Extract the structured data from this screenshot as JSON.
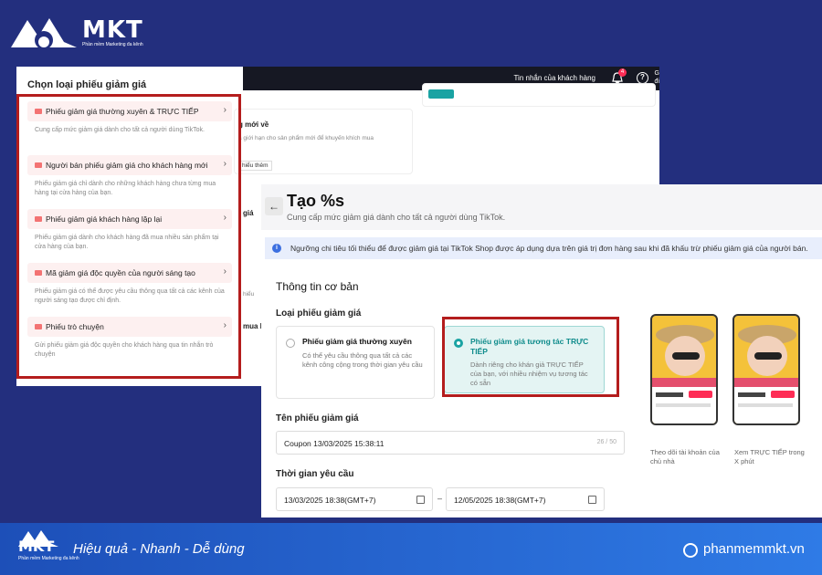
{
  "brand": {
    "name": "MKT",
    "tagline": "Phần mềm Marketing đa kênh",
    "slogan": "Hiệu quả - Nhanh - Dễ dùng",
    "website": "phanmemmkt.vn"
  },
  "topbar": {
    "messages_label": "Tin nhắn của khách hàng",
    "notification_count": "4",
    "help_symbol": "?",
    "user_initials": "G\nđi"
  },
  "voucher_type_panel": {
    "title": "Chọn loại phiếu giảm giá",
    "options": [
      {
        "label": "Phiếu giảm giá thường xuyên & TRỰC TIẾP",
        "desc": "Cung cấp mức giảm giá dành cho tất cả người dùng TikTok."
      },
      {
        "label": "Người bán phiếu giảm giá cho khách hàng mới",
        "desc": "Phiếu giảm giá chỉ dành cho những khách hàng chưa từng mua hàng tại cửa hàng của bạn."
      },
      {
        "label": "Phiếu giảm giá khách hàng lặp lại",
        "desc": "Phiếu giảm giá dành cho khách hàng đã mua nhiều sản phẩm tại cửa hàng của bạn."
      },
      {
        "label": "Mã giảm giá độc quyền của người sáng tạo",
        "desc": "Phiếu giảm giá có thể được yêu cầu thông qua tất cả các kênh của người sáng tạo được chỉ định."
      },
      {
        "label": "Phiếu trò chuyện",
        "desc": "Gửi phiếu giảm giá độc quyền cho khách hàng qua tin nhắn trò chuyện"
      }
    ]
  },
  "background_fragments": {
    "new_product_title": "g mới về",
    "new_product_desc": "à giới hạn cho sản phẩm mới để khuyến khích mua",
    "learn_more": "hiểu thêm",
    "frag_gia": "giá",
    "frag_mua": "mua l",
    "frag_hieu": "hiểu"
  },
  "create_form": {
    "back_symbol": "←",
    "title": "Tạo %s",
    "subtitle": "Cung cấp mức giảm giá dành cho tất cả người dùng TikTok.",
    "notice_icon": "i",
    "notice": "Ngưỡng chi tiêu tối thiểu để được giảm giá tại TikTok Shop được áp dụng dựa trên giá trị đơn hàng sau khi đã khấu trừ phiếu giảm giá của người bán.",
    "section_basic": "Thông tin cơ bản",
    "voucher_type_label": "Loại phiếu giảm giá",
    "types": [
      {
        "title": "Phiếu giảm giá thường xuyên",
        "desc": "Có thể yêu cầu thông qua tất cả các kênh công cộng trong thời gian yêu cầu",
        "selected": false
      },
      {
        "title": "Phiếu giảm giá tương tác TRỰC TIẾP",
        "desc": "Dành riêng cho khán giả TRỰC TIẾP của bạn, với nhiều nhiệm vụ tương tác có sẵn",
        "selected": true
      }
    ],
    "name_label": "Tên phiếu giảm giá",
    "name_value": "Coupon 13/03/2025 15:38:11",
    "name_counter": "26 / 50",
    "time_label": "Thời gian yêu cầu",
    "start_time": "13/03/2025 18:38(GMT+7)",
    "time_separator": "–",
    "end_time": "12/05/2025 18:38(GMT+7)",
    "preview_captions": [
      "Theo dõi tài khoản của chủ nhà",
      "Xem TRỰC TIẾP trong X phút"
    ]
  },
  "colors": {
    "accent": "#1aa3a3",
    "highlight": "#b41d1d",
    "bg": "#232f7e"
  }
}
